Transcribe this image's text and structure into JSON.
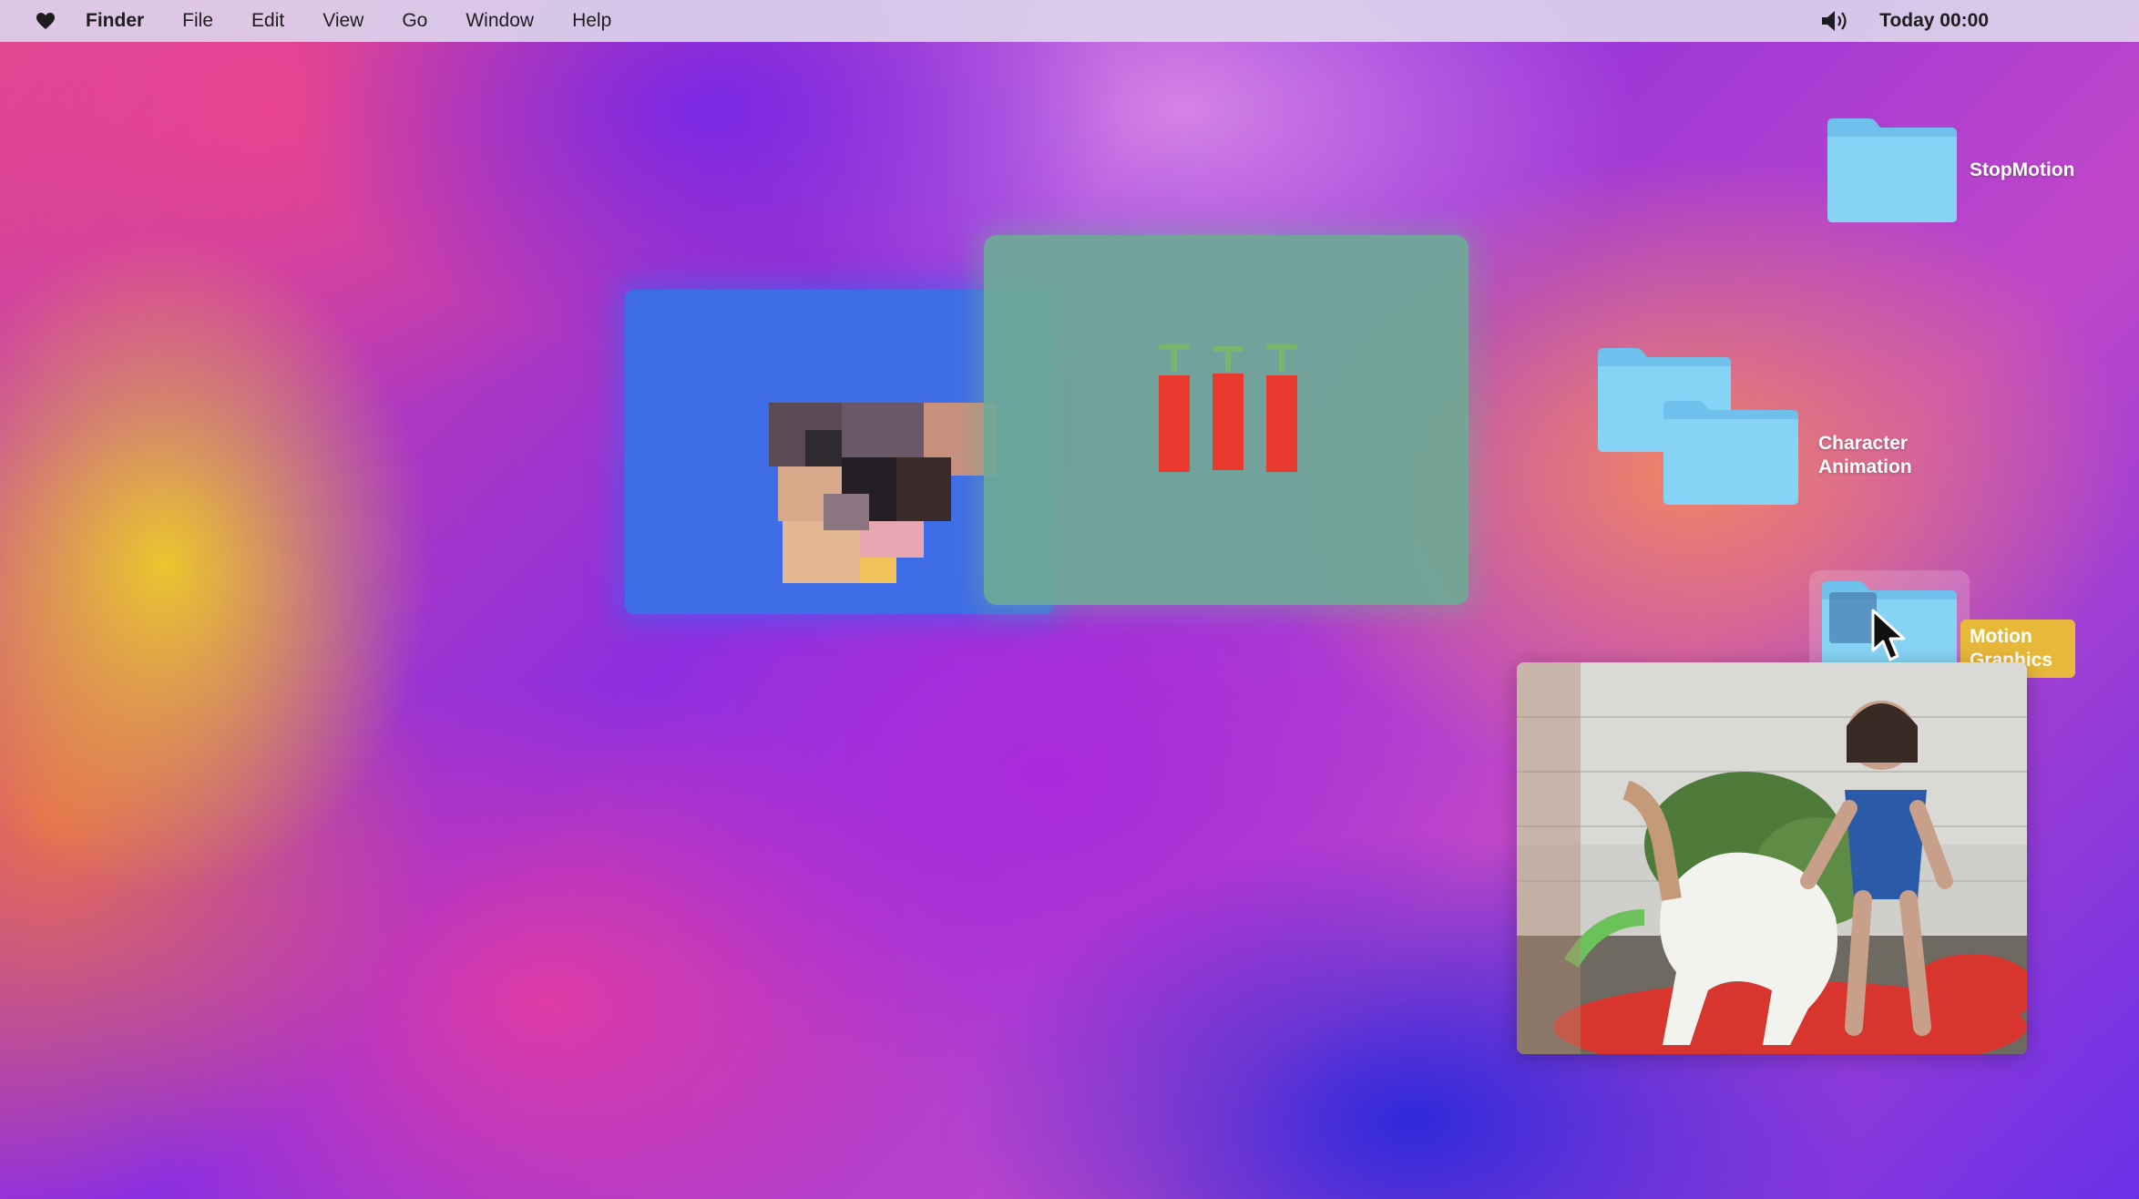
{
  "menubar": {
    "apple_icon": "heart-icon",
    "items": [
      "Finder",
      "File",
      "Edit",
      "View",
      "Go",
      "Window",
      "Help"
    ],
    "volume_icon": "speaker-icon",
    "clock": "Today 00:00"
  },
  "desktop": {
    "folders": [
      {
        "name": "StopMotion",
        "icon": "folder-icon"
      },
      {
        "name": "Character Animation",
        "icon": "folder-stack-icon"
      },
      {
        "name": "Motion Graphics",
        "icon": "folder-icon",
        "selected": true
      }
    ],
    "windows": [
      {
        "name": "collage-window",
        "accent": "#3f6de8"
      },
      {
        "name": "bars-window",
        "accent": "#6eaa96"
      },
      {
        "name": "photo-window"
      }
    ]
  },
  "colors": {
    "folder_blue": "#7cc8f0",
    "selection_yellow": "#e8b83a",
    "bar_red": "#e83a2e"
  }
}
